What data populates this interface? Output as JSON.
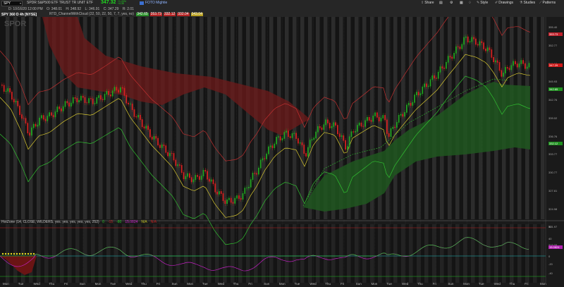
{
  "symbol_bar": {
    "symbol": "SPY",
    "description": "SPDR S&P500 ETF TRUST TR UNIT ETF",
    "price": "347.32",
    "change_line1": "+1.20%",
    "change_line2": "+4.35",
    "highlight_label": "FOTO Mightie"
  },
  "toolbar": {
    "share": "Share",
    "style": "Style",
    "drawings": "Drawings",
    "studies": "Studies",
    "patterns": "Patterns"
  },
  "ohlc": {
    "date": "D: 10/16/20 12:00 PM",
    "open": "O: 348.01",
    "high": "H: 348.92",
    "low": "L: 346.91",
    "close": "C: 347.29",
    "range": "R: 2.01"
  },
  "chart_title": "SPY 360 D 4h [NYSE]",
  "study_label": "RTD_ChannelWithCloud (22, 50, 22, 50, 7, 7, yes, no)",
  "study_values": [
    {
      "text": "342.65",
      "color": "#2a8f2a"
    },
    {
      "text": "353.73",
      "color": "#b32424"
    },
    {
      "text": "332.12",
      "color": "#b32424"
    },
    {
      "text": "332.04",
      "color": "#b32424"
    },
    {
      "text": "343.04",
      "color": "#b8a020"
    }
  ],
  "price_axis": [
    "355.40",
    "352.77",
    "349.12",
    "345.93",
    "342.76",
    "339.02",
    "336.76",
    "333.77",
    "330.77",
    "327.81",
    "324.98",
    "321.97",
    "319.09"
  ],
  "price_tags": [
    {
      "text": "353.73",
      "color": "#c0202a"
    },
    {
      "text": "347.29",
      "color": "#d01818"
    },
    {
      "text": "342.65",
      "color": "#1e8f1e"
    },
    {
      "text": "332.12",
      "color": "#1e8f1e"
    }
  ],
  "indicator": {
    "title": "HotZone (14, CLOSE, WILDERS, yes, yes, yes, yes, yes, 252)",
    "values": [
      {
        "text": "0",
        "color": "#20c020"
      },
      {
        "text": "-15",
        "color": "#c02020"
      },
      {
        "text": "-80",
        "color": "#20c020"
      },
      {
        "text": "15.0824",
        "color": "#d020d0"
      },
      {
        "text": "N/A",
        "color": "#c0c020"
      },
      {
        "text": "N/A",
        "color": "#c02020"
      }
    ],
    "axis": [
      "50",
      "40",
      "20",
      "0",
      "-20",
      "-40"
    ],
    "tag": "15.0824"
  },
  "days": [
    "Mon",
    "Tue",
    "Wed",
    "Thu",
    "Fri",
    "Sun",
    "Mon",
    "Tue",
    "Wed",
    "Thu",
    "Fri",
    "Sun",
    "Mon",
    "Tue",
    "Wed",
    "Thu",
    "Fri",
    "Sun",
    "Mon",
    "Tue",
    "Wed",
    "Thu",
    "Fri",
    "Sun",
    "Mon",
    "Tue",
    "Wed",
    "Thu",
    "Fri",
    "Sun",
    "Mon",
    "Tue",
    "Wed",
    "Thu",
    "Fri",
    "Mon"
  ],
  "watermark": "SPOR",
  "colors": {
    "up": "#1fa31f",
    "down": "#d42020",
    "cloud_red": "#6e1a1a",
    "cloud_green": "#1f5a1f",
    "yellow": "#d8c830",
    "green_band": "#30c030",
    "red_band": "#c03030",
    "magenta": "#c020c0",
    "cyan": "#20c0c0"
  }
}
